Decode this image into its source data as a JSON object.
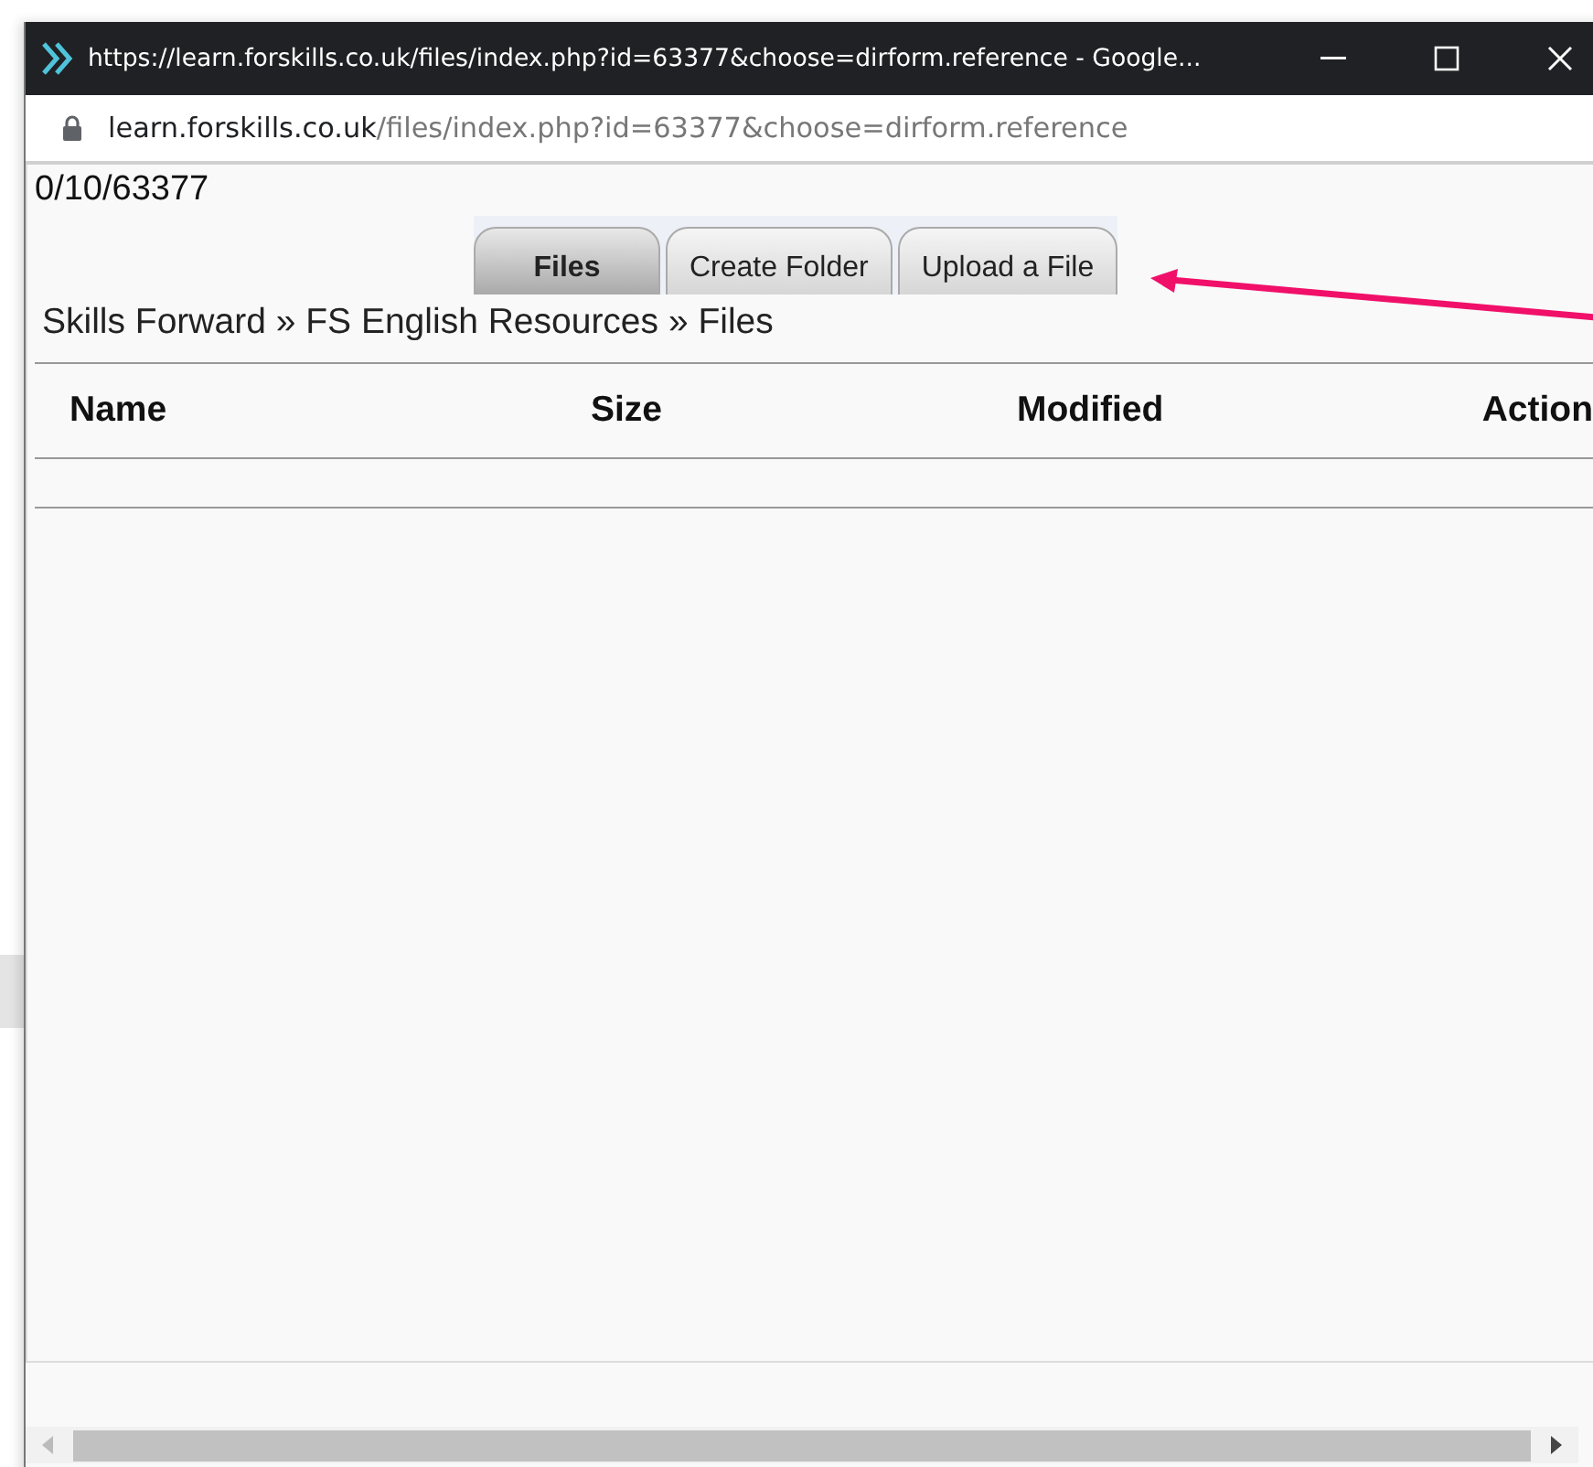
{
  "window": {
    "title": "https://learn.forskills.co.uk/files/index.php?id=63377&choose=dirform.reference - Google..."
  },
  "address_bar": {
    "host": "learn.forskills.co.uk",
    "path": "/files/index.php?id=63377&choose=dirform.reference"
  },
  "path_label": "0/10/63377",
  "tabs": [
    {
      "label": "Files",
      "selected": true
    },
    {
      "label": "Create Folder",
      "selected": false
    },
    {
      "label": "Upload a File",
      "selected": false
    }
  ],
  "breadcrumb": "Skills Forward » FS English Resources » Files",
  "table": {
    "columns": [
      "Name",
      "Size",
      "Modified",
      "Action"
    ]
  }
}
